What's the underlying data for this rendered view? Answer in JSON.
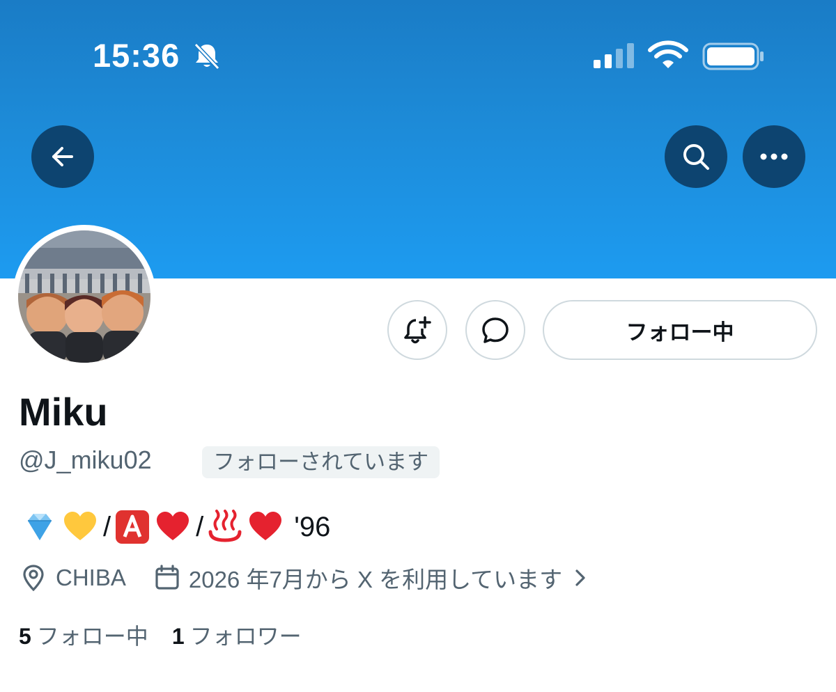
{
  "status_bar": {
    "time": "15:36",
    "icons": [
      "bell-slash-icon",
      "signal-icon",
      "wifi-icon",
      "battery-icon"
    ]
  },
  "header_actions": {
    "back_icon": "arrow-left-icon",
    "search_icon": "search-icon",
    "more_icon": "more-horizontal-icon"
  },
  "profile": {
    "display_name": "Miku",
    "handle": "@J_miku02",
    "follows_you": "フォローされています",
    "bio": {
      "emojis": [
        "gem-emoji",
        "yellow-heart-emoji",
        "a-button-emoji",
        "red-heart-emoji",
        "hot-springs-emoji",
        "red-heart-emoji"
      ],
      "slash": "/",
      "text": "'96"
    },
    "location": "CHIBA",
    "joined": "2026 年7月から X を利用しています",
    "following_count": "5",
    "following_label": "フォロー中",
    "followers_count": "1",
    "followers_label": "フォロワー"
  },
  "actions": {
    "notify_icon": "bell-plus-icon",
    "message_icon": "message-icon",
    "follow_button": "フォロー中"
  },
  "colors": {
    "banner": "#1d9bf0",
    "header_button": "#0d4470",
    "secondary_text": "#536471",
    "primary_text": "#0f1419"
  }
}
